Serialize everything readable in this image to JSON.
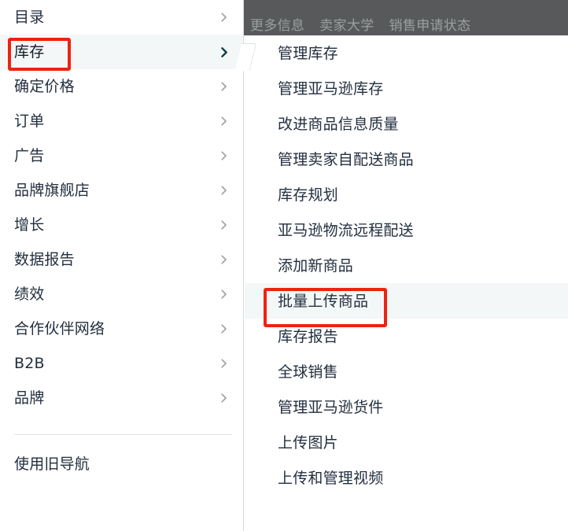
{
  "top_bar": {
    "links": [
      "更多信息",
      "卖家大学",
      "销售申请状态"
    ],
    "background_color": "#58595B",
    "text_color": "#9AA0A0"
  },
  "sidebar": {
    "items": [
      {
        "label": "目录",
        "active": false,
        "chevron": "chevron-right-icon"
      },
      {
        "label": "库存",
        "active": true,
        "chevron": "chevron-right-icon"
      },
      {
        "label": "确定价格",
        "active": false,
        "chevron": "chevron-right-icon"
      },
      {
        "label": "订单",
        "active": false,
        "chevron": "chevron-right-icon"
      },
      {
        "label": "广告",
        "active": false,
        "chevron": "chevron-right-icon"
      },
      {
        "label": "品牌旗舰店",
        "active": false,
        "chevron": "chevron-right-icon"
      },
      {
        "label": "增长",
        "active": false,
        "chevron": "chevron-right-icon"
      },
      {
        "label": "数据报告",
        "active": false,
        "chevron": "chevron-right-icon"
      },
      {
        "label": "绩效",
        "active": false,
        "chevron": "chevron-right-icon"
      },
      {
        "label": "合作伙伴网络",
        "active": false,
        "chevron": "chevron-right-icon"
      },
      {
        "label": "B2B",
        "active": false,
        "chevron": "chevron-right-icon"
      },
      {
        "label": "品牌",
        "active": false,
        "chevron": "chevron-right-icon"
      }
    ],
    "footer": {
      "label": "使用旧导航"
    }
  },
  "flyout": {
    "parent": "库存",
    "items": [
      {
        "label": "管理库存",
        "hovered": false
      },
      {
        "label": "管理亚马逊库存",
        "hovered": false
      },
      {
        "label": "改进商品信息质量",
        "hovered": false
      },
      {
        "label": "管理卖家自配送商品",
        "hovered": false
      },
      {
        "label": "库存规划",
        "hovered": false
      },
      {
        "label": "亚马逊物流远程配送",
        "hovered": false
      },
      {
        "label": "添加新商品",
        "hovered": false
      },
      {
        "label": "批量上传商品",
        "hovered": true
      },
      {
        "label": "库存报告",
        "hovered": false
      },
      {
        "label": "全球销售",
        "hovered": false
      },
      {
        "label": "管理亚马逊货件",
        "hovered": false
      },
      {
        "label": "上传图片",
        "hovered": false
      },
      {
        "label": "上传和管理视频",
        "hovered": false
      }
    ]
  },
  "annotations": {
    "color": "#EE2211",
    "boxes": [
      {
        "target": "库存",
        "name": "highlight-inventory"
      },
      {
        "target": "批量上传商品",
        "name": "highlight-bulk-upload"
      }
    ]
  }
}
